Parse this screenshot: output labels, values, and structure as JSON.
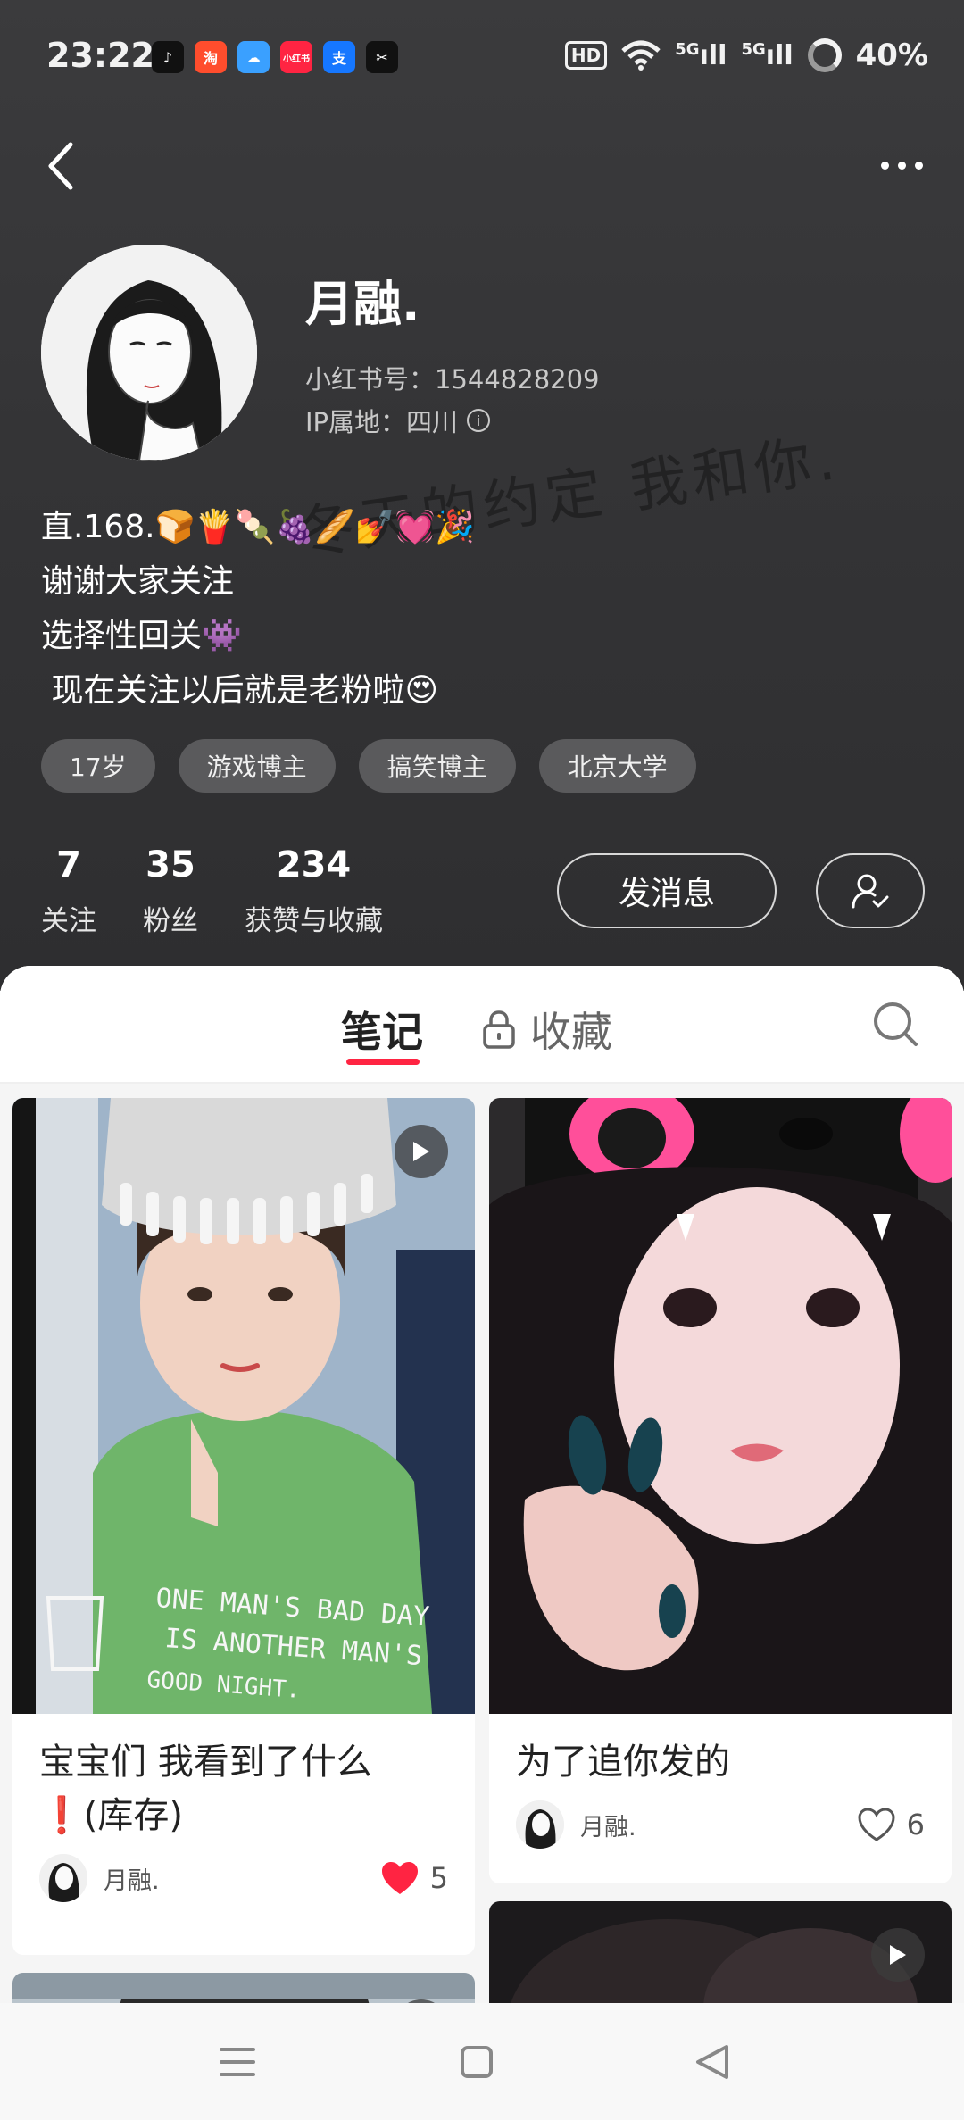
{
  "status_bar": {
    "time": "23:22",
    "notifications": [
      {
        "icon": "tiktok-icon",
        "label": "♪",
        "color": "#111111"
      },
      {
        "icon": "taobao-icon",
        "label": "淘",
        "color": "#ff4d2d"
      },
      {
        "icon": "weather-icon",
        "label": "☁",
        "color": "#3aa0ff"
      },
      {
        "icon": "rednote-icon",
        "label": "小红书",
        "color": "#ff2442"
      },
      {
        "icon": "alipay-icon",
        "label": "支",
        "color": "#1677ff"
      },
      {
        "icon": "capcut-icon",
        "label": "✂",
        "color": "#111111"
      }
    ],
    "hd": "HD",
    "signal_1": "5G",
    "signal_2": "5G",
    "battery": "40%"
  },
  "watermark": "冬天的约定 我和你.",
  "profile": {
    "nickname": "月融.",
    "rednote_id": "小红书号：1544828209",
    "ip": "IP属地：四川",
    "bio": [
      "直.168.🍞🍟🍡🍇🥖💅💓🎉",
      "谢谢大家关注",
      "选择性回关👾",
      " 现在关注以后就是老粉啦😍"
    ],
    "tags": [
      "17岁",
      "游戏博主",
      "搞笑博主",
      "北京大学"
    ],
    "stats": [
      {
        "num": "7",
        "label": "关注"
      },
      {
        "num": "35",
        "label": "粉丝"
      },
      {
        "num": "234",
        "label": "获赞与收藏"
      }
    ],
    "message_button": "发消息"
  },
  "tabs": {
    "notes": "笔记",
    "collect": "收藏"
  },
  "notes": [
    {
      "title": "宝宝们 我看到了什么❗️(库存)",
      "author": "月融.",
      "likes": "5",
      "liked": true,
      "video": true,
      "shirt_text": "ONE MAN'S BAD DAY IS ANOTHER MAN'S GOOD NIGHT."
    },
    {
      "title": "为了追你发的",
      "author": "月融.",
      "likes": "6",
      "liked": false,
      "video": false
    }
  ],
  "colors": {
    "accent": "#ff2442",
    "header_bg": "#343436"
  }
}
